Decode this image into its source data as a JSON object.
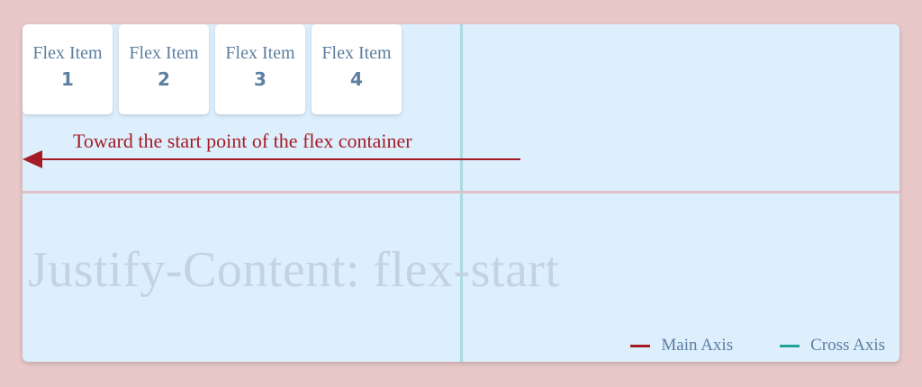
{
  "colors": {
    "page_background": "#e9c8c9",
    "container_background": "#ddeefc",
    "item_text": "#5d7fa0",
    "main_axis": "#a51d24",
    "cross_axis": "#1fa396",
    "main_axis_line": "#e0c0c8",
    "cross_axis_line": "#a9dbe0",
    "watermark": "#c4d3e3"
  },
  "flex_items": [
    {
      "label": "Flex Item",
      "number": "1"
    },
    {
      "label": "Flex Item",
      "number": "2"
    },
    {
      "label": "Flex Item",
      "number": "3"
    },
    {
      "label": "Flex Item",
      "number": "4"
    }
  ],
  "direction_text": "Toward the start point of the flex container",
  "watermark_text": "Justify-Content: flex-start",
  "legend": {
    "main_axis": "Main Axis",
    "cross_axis": "Cross Axis"
  },
  "icons": {
    "arrow": "arrow-left-icon"
  }
}
